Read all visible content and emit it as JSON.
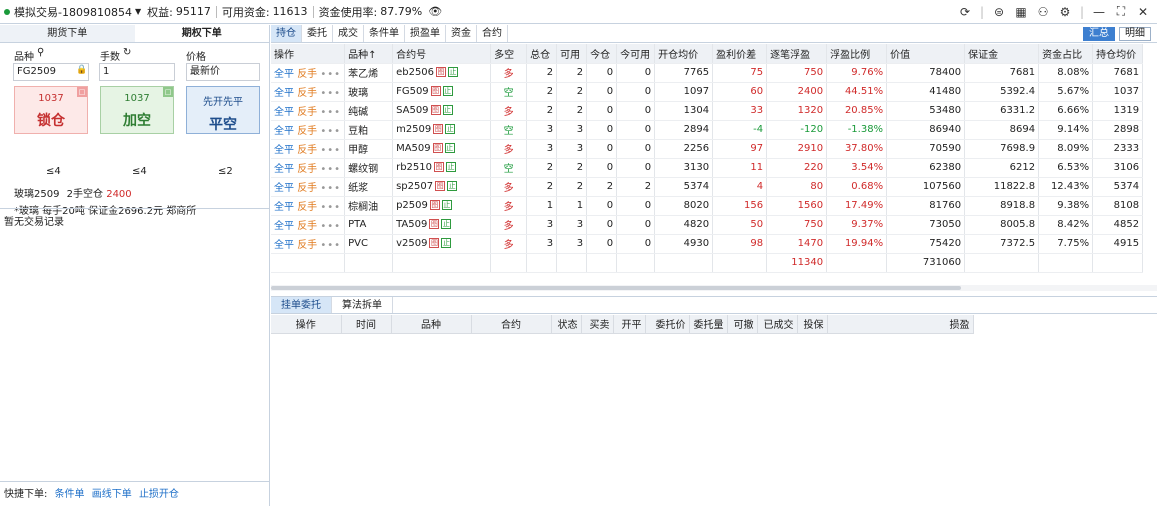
{
  "header": {
    "account": "模拟交易-1809810854",
    "equity_label": "权益:",
    "equity": "95117",
    "available_label": "可用资金:",
    "available": "11613",
    "usage_label": "资金使用率:",
    "usage": "87.79%"
  },
  "left": {
    "tabs": [
      "期货下单",
      "期权下单"
    ],
    "symbol_label": "品种",
    "qty_label": "手数",
    "price_label": "价格",
    "symbol_value": "FG2509",
    "qty_value": "1",
    "price_value": "最新价",
    "buttons": [
      {
        "price": "1037",
        "label": "锁仓",
        "limit": "≤4"
      },
      {
        "price": "1037",
        "label": "加空",
        "limit": "≤4"
      },
      {
        "price": "先开先平",
        "label": "平空",
        "limit": "≤2"
      }
    ],
    "info1_a": "玻璃2509",
    "info1_b": "2手空仓",
    "info1_c": "2400",
    "info2": "*玻璃 每手20吨 保证金2696.2元 郑商所",
    "no_record": "暂无交易记录",
    "quick_label": "快捷下单:",
    "quick_links": [
      "条件单",
      "画线下单",
      "止损开仓"
    ]
  },
  "tabs": [
    "持仓",
    "委托",
    "成交",
    "条件单",
    "损盈单",
    "资金",
    "合约"
  ],
  "summary_buttons": [
    "汇总",
    "明细"
  ],
  "positions": {
    "columns": [
      "操作",
      "品种↑",
      "合约号",
      "多空",
      "总仓",
      "可用",
      "今仓",
      "今可用",
      "开仓均价",
      "盈利价差",
      "逐笔浮盈",
      "浮盈比例",
      "价值",
      "保证金",
      "资金占比",
      "持仓均价"
    ],
    "rows": [
      [
        "苯乙烯",
        "eb2506",
        "多",
        "2",
        "2",
        "0",
        "0",
        "7765",
        "75",
        "750",
        "9.76%",
        "78400",
        "7681",
        "8.08%",
        "7681"
      ],
      [
        "玻璃",
        "FG509",
        "空",
        "2",
        "2",
        "0",
        "0",
        "1097",
        "60",
        "2400",
        "44.51%",
        "41480",
        "5392.4",
        "5.67%",
        "1037"
      ],
      [
        "纯碱",
        "SA509",
        "多",
        "2",
        "2",
        "0",
        "0",
        "1304",
        "33",
        "1320",
        "20.85%",
        "53480",
        "6331.2",
        "6.66%",
        "1319"
      ],
      [
        "豆粕",
        "m2509",
        "空",
        "3",
        "3",
        "0",
        "0",
        "2894",
        "-4",
        "-120",
        "-1.38%",
        "86940",
        "8694",
        "9.14%",
        "2898"
      ],
      [
        "甲醇",
        "MA509",
        "多",
        "3",
        "3",
        "0",
        "0",
        "2256",
        "97",
        "2910",
        "37.80%",
        "70590",
        "7698.9",
        "8.09%",
        "2333"
      ],
      [
        "螺纹钢",
        "rb2510",
        "空",
        "2",
        "2",
        "0",
        "0",
        "3130",
        "11",
        "220",
        "3.54%",
        "62380",
        "6212",
        "6.53%",
        "3106"
      ],
      [
        "纸浆",
        "sp2507",
        "多",
        "2",
        "2",
        "2",
        "2",
        "5374",
        "4",
        "80",
        "0.68%",
        "107560",
        "11822.8",
        "12.43%",
        "5374"
      ],
      [
        "棕榈油",
        "p2509",
        "多",
        "1",
        "1",
        "0",
        "0",
        "8020",
        "156",
        "1560",
        "17.49%",
        "81760",
        "8918.8",
        "9.38%",
        "8108"
      ],
      [
        "PTA",
        "TA509",
        "多",
        "3",
        "3",
        "0",
        "0",
        "4820",
        "50",
        "750",
        "9.37%",
        "73050",
        "8005.8",
        "8.42%",
        "4852"
      ],
      [
        "PVC",
        "v2509",
        "多",
        "3",
        "3",
        "0",
        "0",
        "4930",
        "98",
        "1470",
        "19.94%",
        "75420",
        "7372.5",
        "7.75%",
        "4915"
      ]
    ],
    "op_a": "全平",
    "op_b": "反手",
    "op_c": "•••",
    "badge_a": "图",
    "badge_b": "止",
    "total_float": "11340",
    "total_value": "731060"
  },
  "bottom_tabs": [
    "挂单委托",
    "算法拆单"
  ],
  "orders_columns": [
    "操作",
    "时间",
    "品种",
    "合约",
    "状态",
    "买卖",
    "开平",
    "委托价",
    "委托量",
    "可撤",
    "已成交",
    "投保",
    "损盈"
  ],
  "colors": {
    "long": "#d02a2a",
    "short": "#1a9a3a",
    "accent": "#1e6fc8"
  }
}
